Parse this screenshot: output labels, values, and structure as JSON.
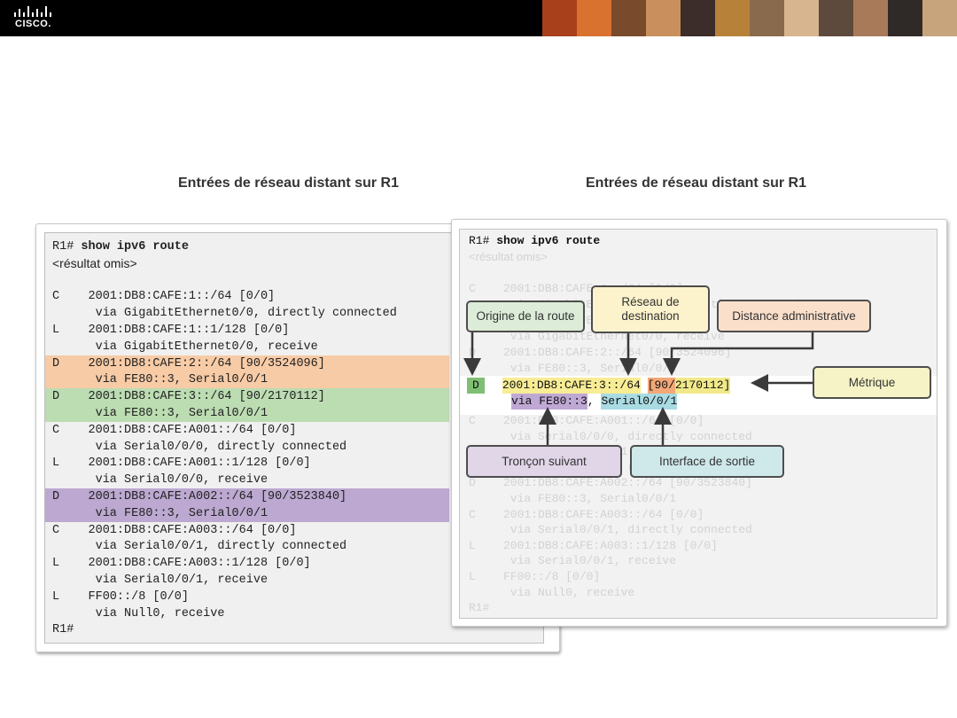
{
  "header": {
    "logo_text": "CISCO.",
    "photo_colors": [
      "#a8401c",
      "#d9712f",
      "#7a4a2c",
      "#c98f5c",
      "#3c2d2a",
      "#b8813a",
      "#8a6a4d",
      "#d7b58e",
      "#5e4a3d",
      "#a97a5a",
      "#2f2a28",
      "#c8a47d"
    ]
  },
  "left": {
    "title": "Entrées de réseau distant sur R1",
    "lines": [
      {
        "prompt": "R1#",
        "cmd": " show ipv6 route"
      },
      {
        "text": "<résultat omis>"
      },
      {
        "text": ""
      },
      {
        "text": "C    2001:DB8:CAFE:1::/64 [0/0]"
      },
      {
        "text": "      via GigabitEthernet0/0, directly connected"
      },
      {
        "text": "L    2001:DB8:CAFE:1::1/128 [0/0]"
      },
      {
        "text": "      via GigabitEthernet0/0, receive"
      },
      {
        "text": "D    2001:DB8:CAFE:2::/64 [90/3524096]"
      },
      {
        "text": "      via FE80::3, Serial0/0/1"
      },
      {
        "text": "D    2001:DB8:CAFE:3::/64 [90/2170112]"
      },
      {
        "text": "      via FE80::3, Serial0/0/1"
      },
      {
        "text": "C    2001:DB8:CAFE:A001::/64 [0/0]"
      },
      {
        "text": "      via Serial0/0/0, directly connected"
      },
      {
        "text": "L    2001:DB8:CAFE:A001::1/128 [0/0]"
      },
      {
        "text": "      via Serial0/0/0, receive"
      },
      {
        "text": "D    2001:DB8:CAFE:A002::/64 [90/3523840]"
      },
      {
        "text": "      via FE80::3, Serial0/0/1"
      },
      {
        "text": "C    2001:DB8:CAFE:A003::/64 [0/0]"
      },
      {
        "text": "      via Serial0/0/1, directly connected"
      },
      {
        "text": "L    2001:DB8:CAFE:A003::1/128 [0/0]"
      },
      {
        "text": "      via Serial0/0/1, receive"
      },
      {
        "text": "L    FF00::/8 [0/0]"
      },
      {
        "text": "      via Null0, receive"
      },
      {
        "text": "R1#"
      }
    ],
    "highlight_colors": {
      "orange": "#f7cba6",
      "green": "#bcdcb2",
      "purple": "#bca8d0"
    }
  },
  "right": {
    "title": "Entrées de réseau distant sur R1",
    "prompt": "R1#",
    "command": " show ipv6 route",
    "omitted": "<résultat omis>",
    "faded_lines_top": [
      "C    2001:DB8:CAFE:1::/64 [0/0]",
      "      via GigabitEthernet0/0, directly connected",
      "L    2001:DB8:CAFE:1::1/128 [0/0]",
      "      via GigabitEthernet0/0, receive",
      "D    2001:DB8:CAFE:2::/64 [90/3524096]",
      "      via FE80::3, Serial0/0/1"
    ],
    "focus": {
      "code": "D",
      "network": "2001:DB8:CAFE:3::/64",
      "bracket_open": "[",
      "ad": "90",
      "slash": "/",
      "metric": "2170112",
      "bracket_close": "]",
      "via": "via",
      "next_hop": "FE80::3",
      "comma": ",",
      "exit_interface": "Serial0/0/1"
    },
    "faded_lines_bottom": [
      "C    2001:DB8:CAFE:A001::/64 [0/0]",
      "      via Serial0/0/0, directly connected",
      "L    2001:DB8:CAFE:A001::1/128 [0/0]",
      "      via Serial0/0/0, receive",
      "D    2001:DB8:CAFE:A002::/64 [90/3523840]",
      "      via FE80::3, Serial0/0/1",
      "C    2001:DB8:CAFE:A003::/64 [0/0]",
      "      via Serial0/0/1, directly connected",
      "L    2001:DB8:CAFE:A003::1/128 [0/0]",
      "      via Serial0/0/1, receive",
      "L    FF00::/8 [0/0]",
      "      via Null0, receive",
      "R1#"
    ],
    "callouts": {
      "origin": "Origine de la route",
      "destination": "Réseau de destination",
      "admin_distance": "Distance administrative",
      "metric": "Métrique",
      "next_hop": "Tronçon suivant",
      "exit_interface": "Interface de sortie"
    },
    "colors": {
      "origin": "#dcecd8",
      "destination": "#fcf3cc",
      "admin_distance": "#fadfcb",
      "metric": "#f6f3c6",
      "next_hop": "#e0d6e8",
      "exit_interface": "#cfe8ea",
      "code_bg": "#7fbf73",
      "network_bg": "#f8ec94",
      "ad_bg": "#f3a877",
      "metric_bg": "#f1e989",
      "next_hop_bg": "#bfa8d4",
      "exit_bg": "#a9dbe3"
    }
  }
}
